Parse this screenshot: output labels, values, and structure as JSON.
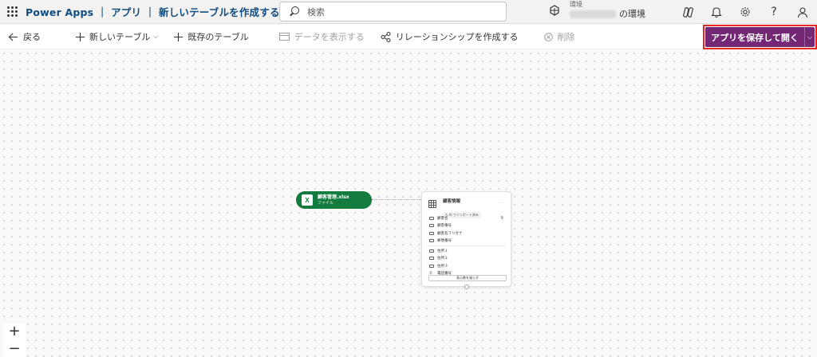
{
  "header": {
    "title": "Power Apps ｜ アプリ ｜ 新しいテーブルを作成する",
    "search_placeholder": "検索",
    "env_label": "環境",
    "env_name": "の環境",
    "icons": [
      "copilot-icon",
      "bell-icon",
      "settings-icon",
      "help-icon",
      "account-icon"
    ]
  },
  "commandbar": {
    "back": "戻る",
    "new_table": "新しいテーブル",
    "existing_table": "既存のテーブル",
    "view_data": "データを表示する",
    "create_relationship": "リレーションシップを作成する",
    "delete": "削除",
    "save_open": "アプリを保存して開く"
  },
  "canvas": {
    "file_node": {
      "name": "顧客管理.xlsx",
      "type": "ファイル"
    },
    "table_card": {
      "title": "顧客情報",
      "badge": "AI でインポート済み",
      "rows_group1": [
        "顧客名",
        "顧客番号",
        "顧客名フリガナ",
        "郵便番号"
      ],
      "rows_group2": [
        "住所１",
        "住所２",
        "住所３",
        "電話番号"
      ],
      "more_button": "表示数を減らす"
    },
    "zoom_in": "+",
    "zoom_out": "−"
  },
  "colors": {
    "brand_title": "#0f4c81",
    "save_button": "#742774",
    "highlight": "#e6261f",
    "excel_green": "#137b3e"
  }
}
